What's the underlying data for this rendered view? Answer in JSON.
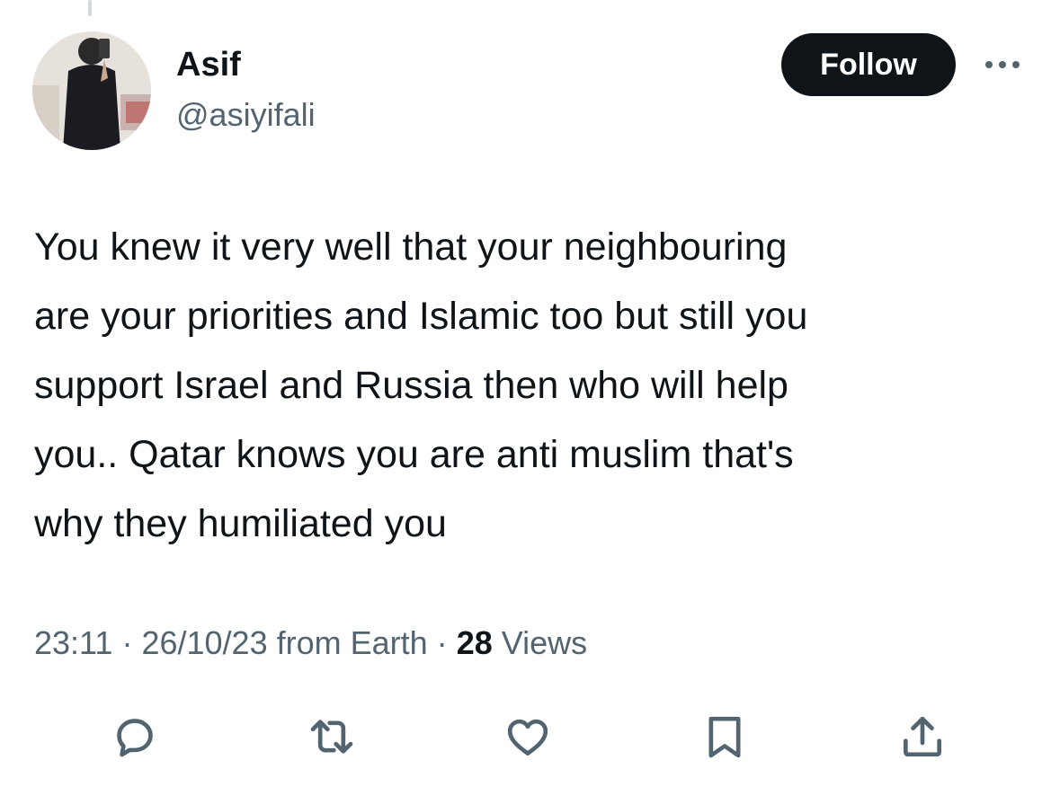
{
  "tweet": {
    "author": {
      "display_name": "Asif",
      "handle": "@asiyifali"
    },
    "follow_label": "Follow",
    "text": "You knew it very well that your neighbouring\nare your priorities and Islamic too but still you\nsupport Israel and Russia then who will help\nyou.. Qatar knows you are anti muslim that's\nwhy they humiliated you",
    "time": "23:11",
    "date": "26/10/23",
    "source": "from Earth",
    "separator": "·",
    "views_count": "28",
    "views_label": "Views"
  },
  "actions": [
    {
      "icon": "reply-icon"
    },
    {
      "icon": "retweet-icon"
    },
    {
      "icon": "like-icon"
    },
    {
      "icon": "bookmark-icon"
    },
    {
      "icon": "share-icon"
    }
  ],
  "colors": {
    "text_primary": "#0f1419",
    "text_secondary": "#536471",
    "follow_bg": "#0f1419",
    "follow_text": "#ffffff"
  }
}
